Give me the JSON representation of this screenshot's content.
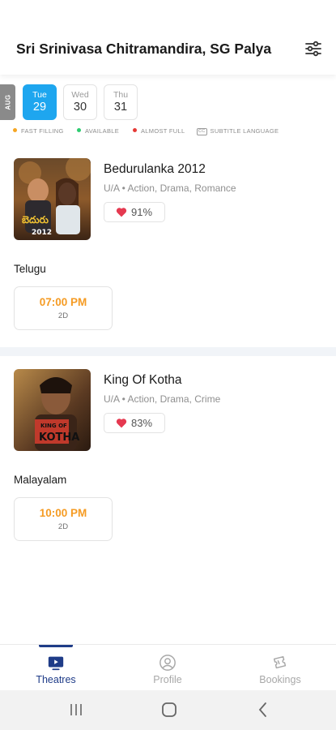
{
  "header": {
    "title": "Sri Srinivasa Chitramandira, SG Palya",
    "filter_icon": "sliders-icon"
  },
  "date_picker": {
    "month": "AUG",
    "dates": [
      {
        "day": "Tue",
        "num": "29",
        "selected": true
      },
      {
        "day": "Wed",
        "num": "30",
        "selected": false
      },
      {
        "day": "Thu",
        "num": "31",
        "selected": false
      }
    ]
  },
  "legend": {
    "fast_filling": "FAST FILLING",
    "available": "AVAILABLE",
    "almost_full": "ALMOST FULL",
    "cc_badge": "CC",
    "subtitle_language": "SUBTITLE LANGUAGE",
    "colors": {
      "fast_filling": "#f5a623",
      "available": "#2ecc71",
      "almost_full": "#e53935"
    }
  },
  "movies": [
    {
      "title": "Bedurulanka 2012",
      "meta": "U/A • Action, Drama, Romance",
      "rating": "91%",
      "language": "Telugu",
      "shows": [
        {
          "time": "07:00 PM",
          "format": "2D"
        }
      ]
    },
    {
      "title": "King Of Kotha",
      "meta": "U/A • Action, Drama, Crime",
      "rating": "83%",
      "language": "Malayalam",
      "shows": [
        {
          "time": "10:00 PM",
          "format": "2D"
        }
      ]
    }
  ],
  "bottom_nav": {
    "theatres": "Theatres",
    "profile": "Profile",
    "bookings": "Bookings",
    "active": "theatres",
    "colors": {
      "active": "#1f3c88",
      "inactive": "#a8a8a8"
    }
  }
}
